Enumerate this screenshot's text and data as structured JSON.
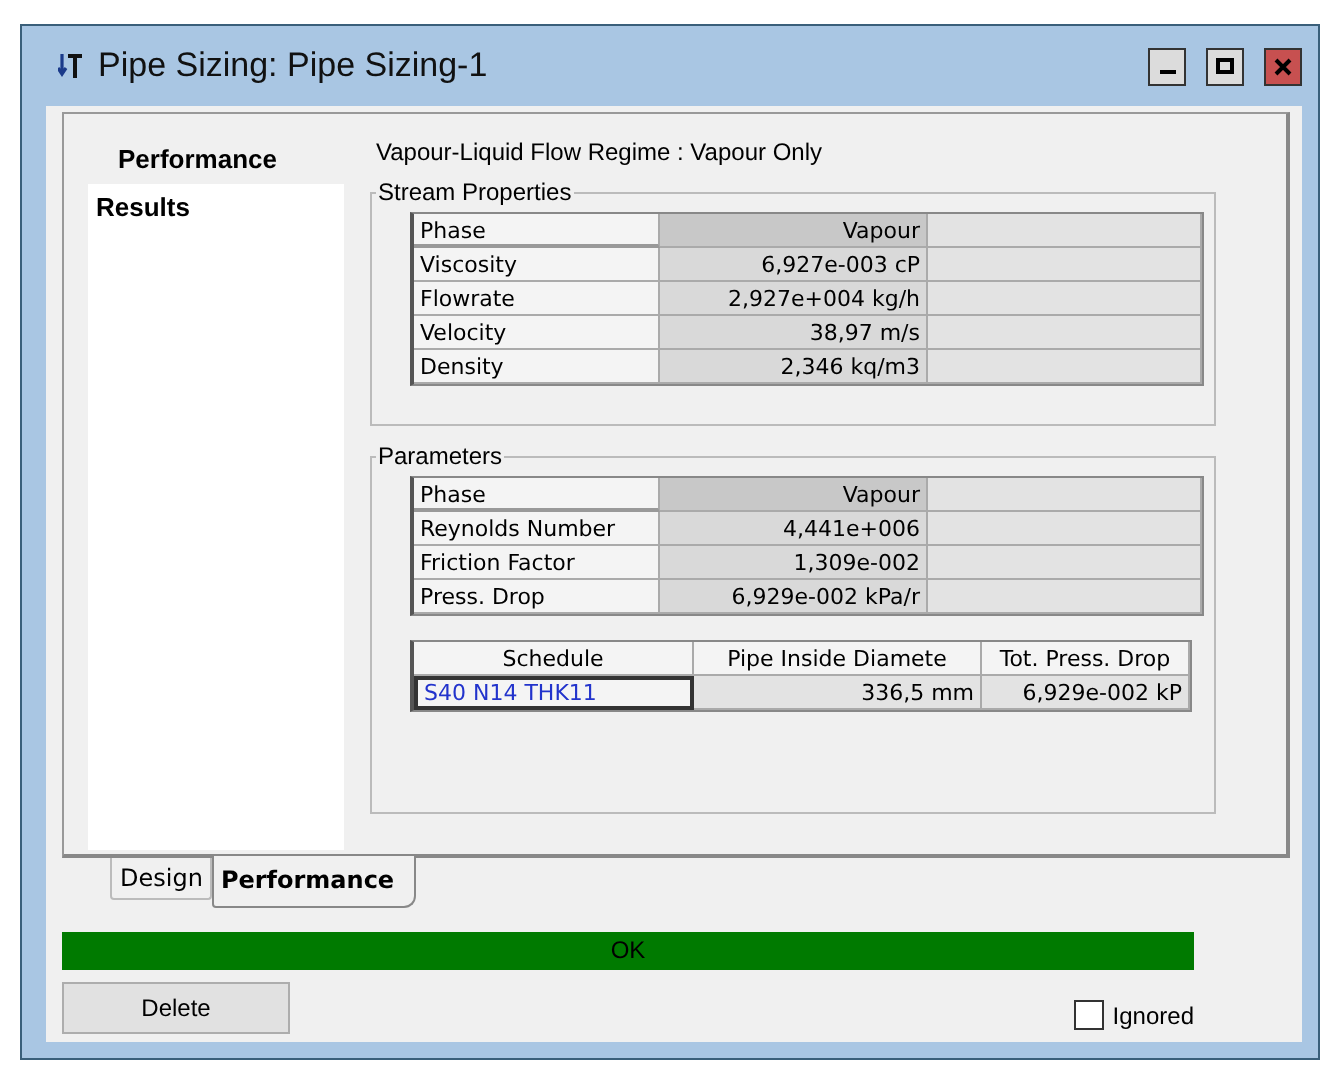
{
  "window": {
    "title": "Pipe Sizing: Pipe Sizing-1",
    "controls": [
      {
        "kind": "minimize"
      },
      {
        "kind": "maximize"
      },
      {
        "kind": "close"
      }
    ]
  },
  "nav": {
    "header": "Performance",
    "items": [
      {
        "label": "Results",
        "selected": true
      }
    ]
  },
  "regime": "Vapour-Liquid Flow Regime : Vapour Only",
  "stream_properties": {
    "title": "Stream Properties",
    "rows": [
      {
        "label": "Phase",
        "value": "Vapour",
        "header": true
      },
      {
        "label": "Viscosity",
        "value": "6,927e-003 cP",
        "header": false
      },
      {
        "label": "Flowrate",
        "value": "2,927e+004 kg/h",
        "header": false
      },
      {
        "label": "Velocity",
        "value": "38,97 m/s",
        "header": false
      },
      {
        "label": "Density",
        "value": "2,346 kq/m3",
        "header": false
      }
    ]
  },
  "parameters": {
    "title": "Parameters",
    "rows": [
      {
        "label": "Phase",
        "value": "Vapour",
        "header": true
      },
      {
        "label": "Reynolds Number",
        "value": "4,441e+006",
        "header": false
      },
      {
        "label": "Friction Factor",
        "value": "1,309e-002",
        "header": false
      },
      {
        "label": "Press. Drop",
        "value": "6,929e-002 kPa/r",
        "header": false
      }
    ],
    "schedule_table": {
      "columns": [
        "Schedule",
        "Pipe Inside Diamete",
        "Tot. Press. Drop"
      ],
      "rows": [
        [
          "S40 N14 THK11",
          "336,5 mm",
          "6,929e-002 kP"
        ]
      ]
    }
  },
  "tabs": [
    {
      "label": "Design",
      "selected": false
    },
    {
      "label": "Performance",
      "selected": true
    }
  ],
  "status": {
    "text": "OK",
    "color": "#007a00"
  },
  "delete_button": "Delete",
  "ignored": {
    "label": "Ignored",
    "checked": false
  }
}
